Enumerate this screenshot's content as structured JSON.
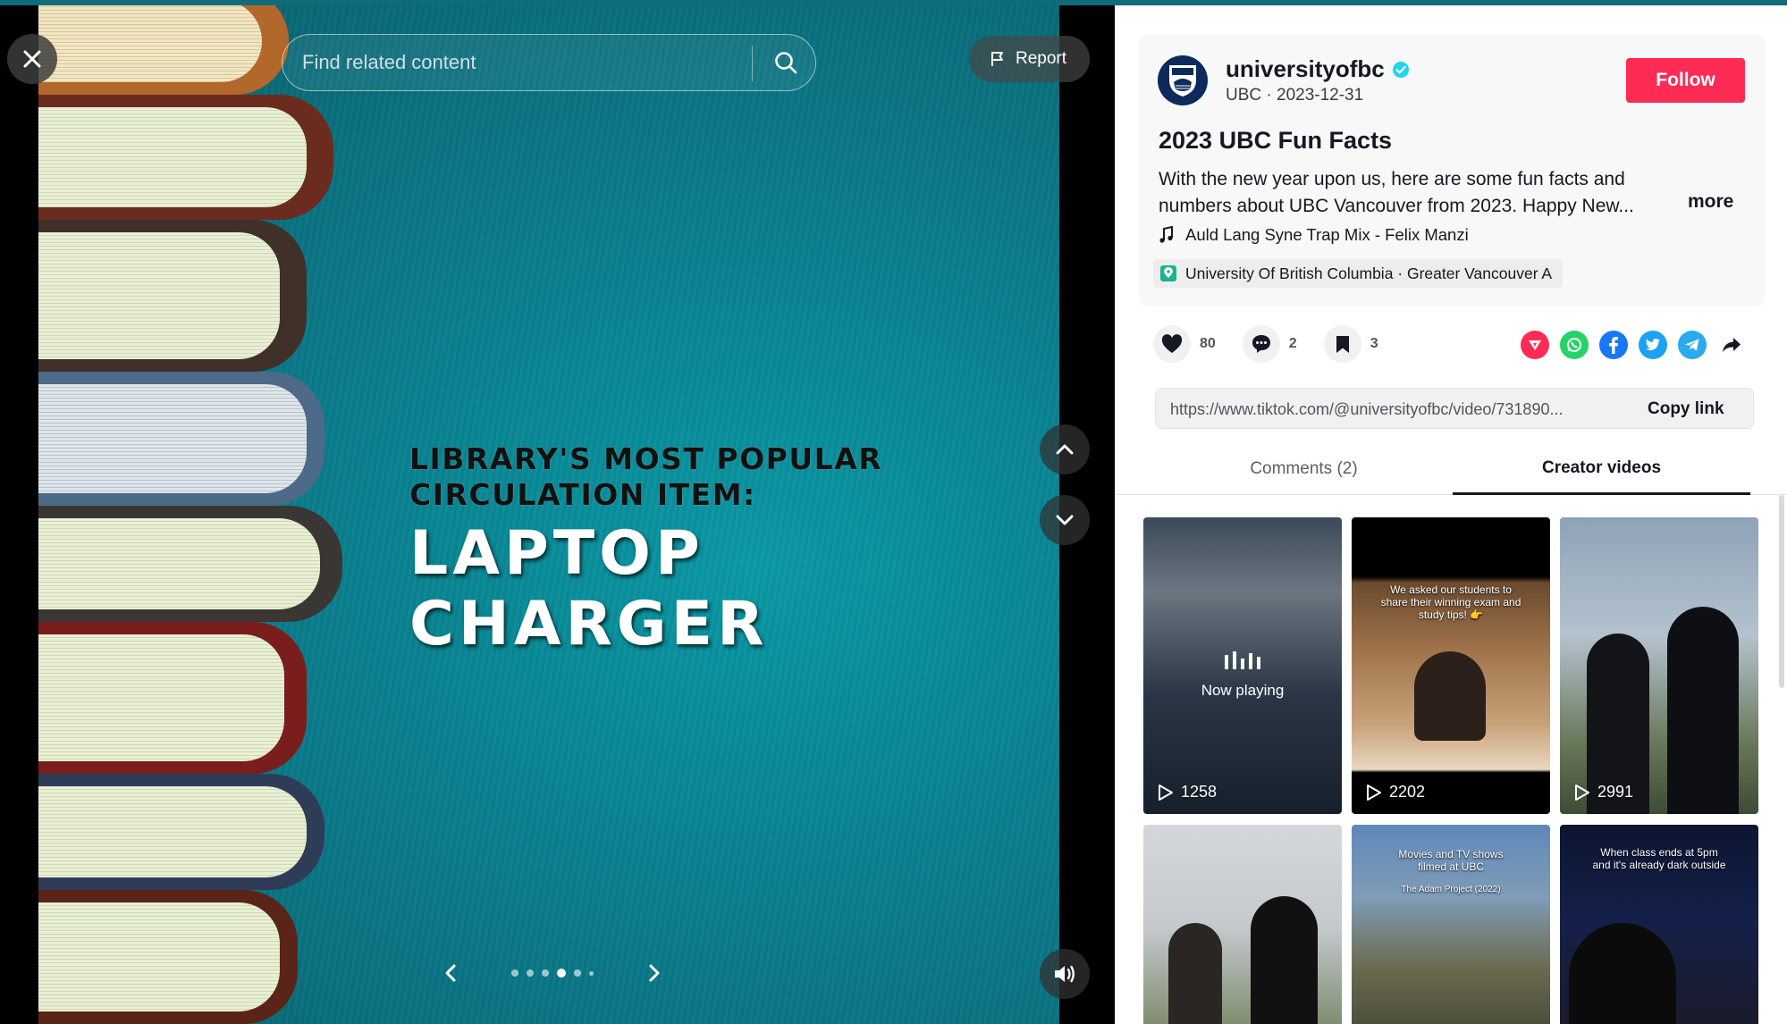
{
  "player": {
    "search_placeholder": "Find related content",
    "report_label": "Report",
    "slide": {
      "line1": "LIBRARY'S MOST POPULAR",
      "line2": "CIRCULATION ITEM:",
      "big": "LAPTOP CHARGER"
    },
    "carousel": {
      "total_dots": 6,
      "active_index": 3
    }
  },
  "post": {
    "username": "universityofbc",
    "verified": true,
    "meta": "UBC · 2023-12-31",
    "follow_label": "Follow",
    "title": "2023 UBC Fun Facts",
    "description": "With the new year upon us, here are some fun facts and numbers about UBC Vancouver from 2023. Happy New...",
    "more_label": "more",
    "music": "Auld Lang Syne Trap Mix - Felix Manzi",
    "location": "University Of British Columbia · Greater Vancouver A",
    "likes": "80",
    "comments": "2",
    "saves": "3",
    "link": "https://www.tiktok.com/@universityofbc/video/731890...",
    "copy_label": "Copy link"
  },
  "share_icons": [
    "tiktok-share-icon",
    "whatsapp-icon",
    "facebook-icon",
    "twitter-icon",
    "telegram-icon",
    "forward-share-icon"
  ],
  "tabs": [
    {
      "label": "Comments (2)",
      "active": false
    },
    {
      "label": "Creator videos",
      "active": true
    }
  ],
  "creator_videos": [
    {
      "views": "1258",
      "status": "Now playing"
    },
    {
      "views": "2202",
      "overlay": "We asked our students to share their winning exam and study tips! 👉"
    },
    {
      "views": "2991"
    },
    {
      "views": ""
    },
    {
      "views": "",
      "overlay": "Movies and TV shows filmed at UBC",
      "sub": "The Adam Project (2022)"
    },
    {
      "views": "",
      "overlay": "When class ends at 5pm and it's already dark outside"
    }
  ],
  "colors": {
    "follow": "#fe2c55",
    "teal_bg": "#0a8b98",
    "verified": "#20d5ec"
  }
}
